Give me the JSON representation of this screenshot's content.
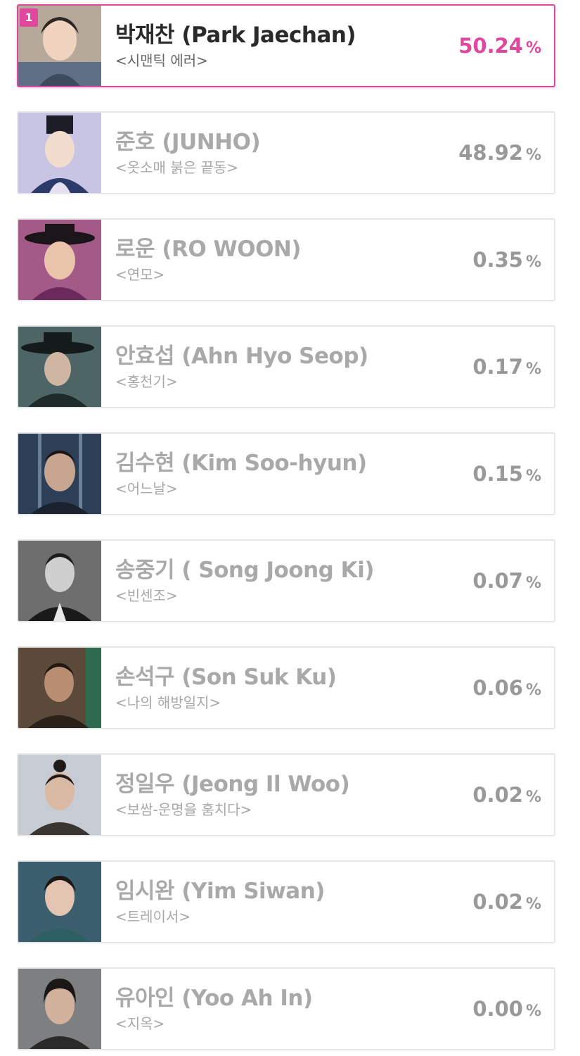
{
  "colors": {
    "accent": "#e0479e",
    "card_border": "#e6e6e6",
    "text_muted": "#a9a9a9",
    "text_strong": "#2a2a2a"
  },
  "percent_unit": "%",
  "items": [
    {
      "rank": "1",
      "name": "박재찬 (Park Jaechan)",
      "work": "<시맨틱 에러>",
      "percent": "50.24",
      "thumb_icon": "actor-portrait"
    },
    {
      "name": "준호 (JUNHO)",
      "work": "<옷소매 붉은 끝동>",
      "percent": "48.92",
      "thumb_icon": "actor-portrait"
    },
    {
      "name": "로운 (RO WOON)",
      "work": "<연모>",
      "percent": "0.35",
      "thumb_icon": "actor-portrait"
    },
    {
      "name": "안효섭 (Ahn Hyo Seop)",
      "work": "<홍천기>",
      "percent": "0.17",
      "thumb_icon": "actor-portrait"
    },
    {
      "name": "김수현 (Kim Soo-hyun)",
      "work": "<어느날>",
      "percent": "0.15",
      "thumb_icon": "actor-portrait"
    },
    {
      "name": "송중기 ( Song Joong Ki)",
      "work": "<빈센조>",
      "percent": "0.07",
      "thumb_icon": "actor-portrait"
    },
    {
      "name": "손석구 (Son Suk Ku)",
      "work": "<나의 해방일지>",
      "percent": "0.06",
      "thumb_icon": "actor-portrait"
    },
    {
      "name": "정일우 (Jeong Il Woo)",
      "work": "<보쌈-운명을 훔치다>",
      "percent": "0.02",
      "thumb_icon": "actor-portrait"
    },
    {
      "name": "임시완 (Yim Siwan)",
      "work": "<트레이서>",
      "percent": "0.02",
      "thumb_icon": "actor-portrait"
    },
    {
      "name": "유아인 (Yoo Ah In)",
      "work": "<지옥>",
      "percent": "0.00",
      "thumb_icon": "actor-portrait"
    }
  ]
}
